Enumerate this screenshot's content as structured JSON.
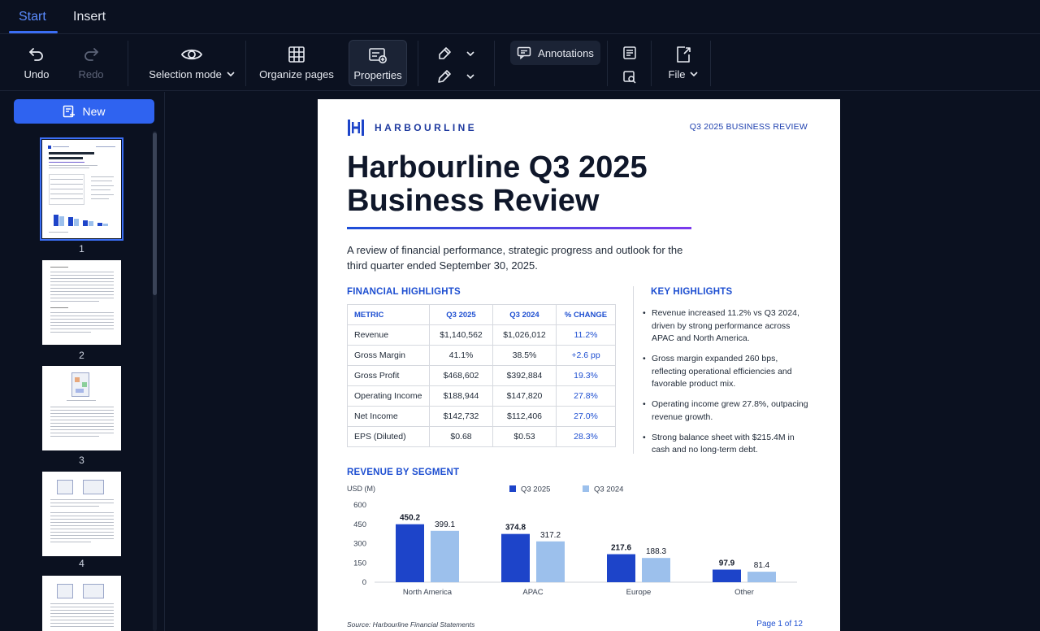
{
  "tabs": [
    {
      "label": "Start",
      "active": true
    },
    {
      "label": "Insert",
      "active": false
    }
  ],
  "toolbar": {
    "undo": "Undo",
    "redo": "Redo",
    "selection_mode": "Selection mode",
    "organize_pages": "Organize pages",
    "properties": "Properties",
    "annotations": "Annotations",
    "file": "File"
  },
  "sidebar": {
    "new_button": "New",
    "pages": [
      "1",
      "2",
      "3",
      "4"
    ]
  },
  "document": {
    "logo_text": "HARBOURLINE",
    "header_right": "Q3 2025 BUSINESS REVIEW",
    "title_line1": "Harbourline Q3 2025",
    "title_line2": "Business Review",
    "subtitle": "A review of financial performance, strategic progress and outlook for the third quarter ended September 30, 2025.",
    "financial_highlights": {
      "heading": "FINANCIAL HIGHLIGHTS",
      "columns": [
        "METRIC",
        "Q3 2025",
        "Q3 2024",
        "% CHANGE"
      ],
      "rows": [
        [
          "Revenue",
          "$1,140,562",
          "$1,026,012",
          "11.2%"
        ],
        [
          "Gross Margin",
          "41.1%",
          "38.5%",
          "+2.6 pp"
        ],
        [
          "Gross Profit",
          "$468,602",
          "$392,884",
          "19.3%"
        ],
        [
          "Operating Income",
          "$188,944",
          "$147,820",
          "27.8%"
        ],
        [
          "Net Income",
          "$142,732",
          "$112,406",
          "27.0%"
        ],
        [
          "EPS (Diluted)",
          "$0.68",
          "$0.53",
          "28.3%"
        ]
      ]
    },
    "key_highlights": {
      "heading": "KEY HIGHLIGHTS",
      "items": [
        "Revenue increased 11.2% vs Q3 2024, driven by strong performance across APAC and North America.",
        "Gross margin expanded 260 bps, reflecting operational efficiencies and favorable product mix.",
        "Operating income grew 27.8%, outpacing revenue growth.",
        "Strong balance sheet with $215.4M in cash and no long-term debt."
      ]
    },
    "revenue_heading": "REVENUE BY SEGMENT",
    "source": "Source: Harbourline Financial Statements",
    "page_indicator": "Page 1 of 12"
  },
  "colors": {
    "accent": "#2f63f0",
    "series_2025": "#1d44c9",
    "series_2024": "#9cc0ec"
  },
  "chart_data": {
    "type": "bar",
    "title": "REVENUE BY SEGMENT",
    "ylabel": "USD (M)",
    "categories": [
      "North America",
      "APAC",
      "Europe",
      "Other"
    ],
    "series": [
      {
        "name": "Q3 2025",
        "values": [
          450.2,
          374.8,
          217.6,
          97.9
        ]
      },
      {
        "name": "Q3 2024",
        "values": [
          399.1,
          317.2,
          188.3,
          81.4
        ]
      }
    ],
    "ylim": [
      0,
      600
    ],
    "yticks": [
      0,
      150,
      300,
      450,
      600
    ],
    "legend": "top",
    "grid": false
  }
}
